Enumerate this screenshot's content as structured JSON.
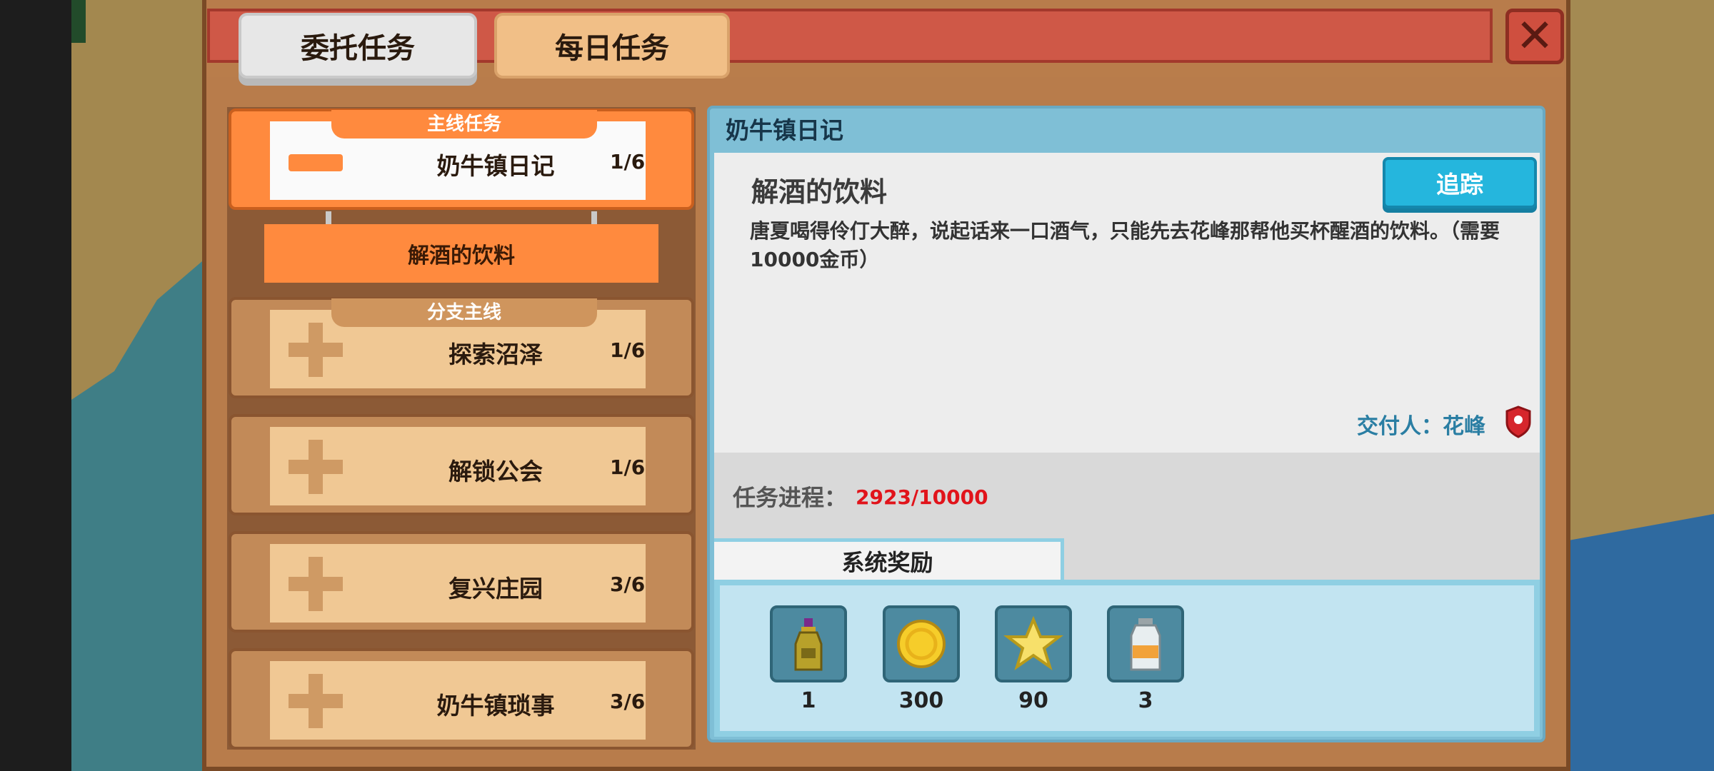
{
  "tabs": {
    "commission": "委托任务",
    "daily": "每日任务"
  },
  "close_icon": "close-icon",
  "quest_list": {
    "main": {
      "category": "主线任务",
      "name": "奶牛镇日记",
      "count": "1/6",
      "sub_quest": "解酒的饮料"
    },
    "items": [
      {
        "category": "分支主线",
        "name": "探索沼泽",
        "count": "1/6"
      },
      {
        "name": "解锁公会",
        "count": "1/6"
      },
      {
        "name": "复兴庄园",
        "count": "3/6"
      },
      {
        "name": "奶牛镇琐事",
        "count": "3/6"
      }
    ]
  },
  "detail": {
    "header": "奶牛镇日记",
    "title": "解酒的饮料",
    "track_button": "追踪",
    "description": "唐夏喝得伶仃大醉，说起话来一口酒气，只能先去花峰那帮他买杯醒酒的饮料。（需要10000金币）",
    "giver": "交付人：花峰",
    "progress_label": "任务进程：",
    "progress_value": "2923/10000",
    "rewards_tab": "系统奖励",
    "rewards": [
      {
        "icon": "bottle-icon",
        "amount": "1"
      },
      {
        "icon": "coin-icon",
        "amount": "300"
      },
      {
        "icon": "star-icon",
        "amount": "90"
      },
      {
        "icon": "milk-jar-icon",
        "amount": "3"
      }
    ]
  },
  "colors": {
    "accent_orange": "#ff8a3e",
    "track_blue": "#25b6dd",
    "progress_red": "#e1141b"
  }
}
